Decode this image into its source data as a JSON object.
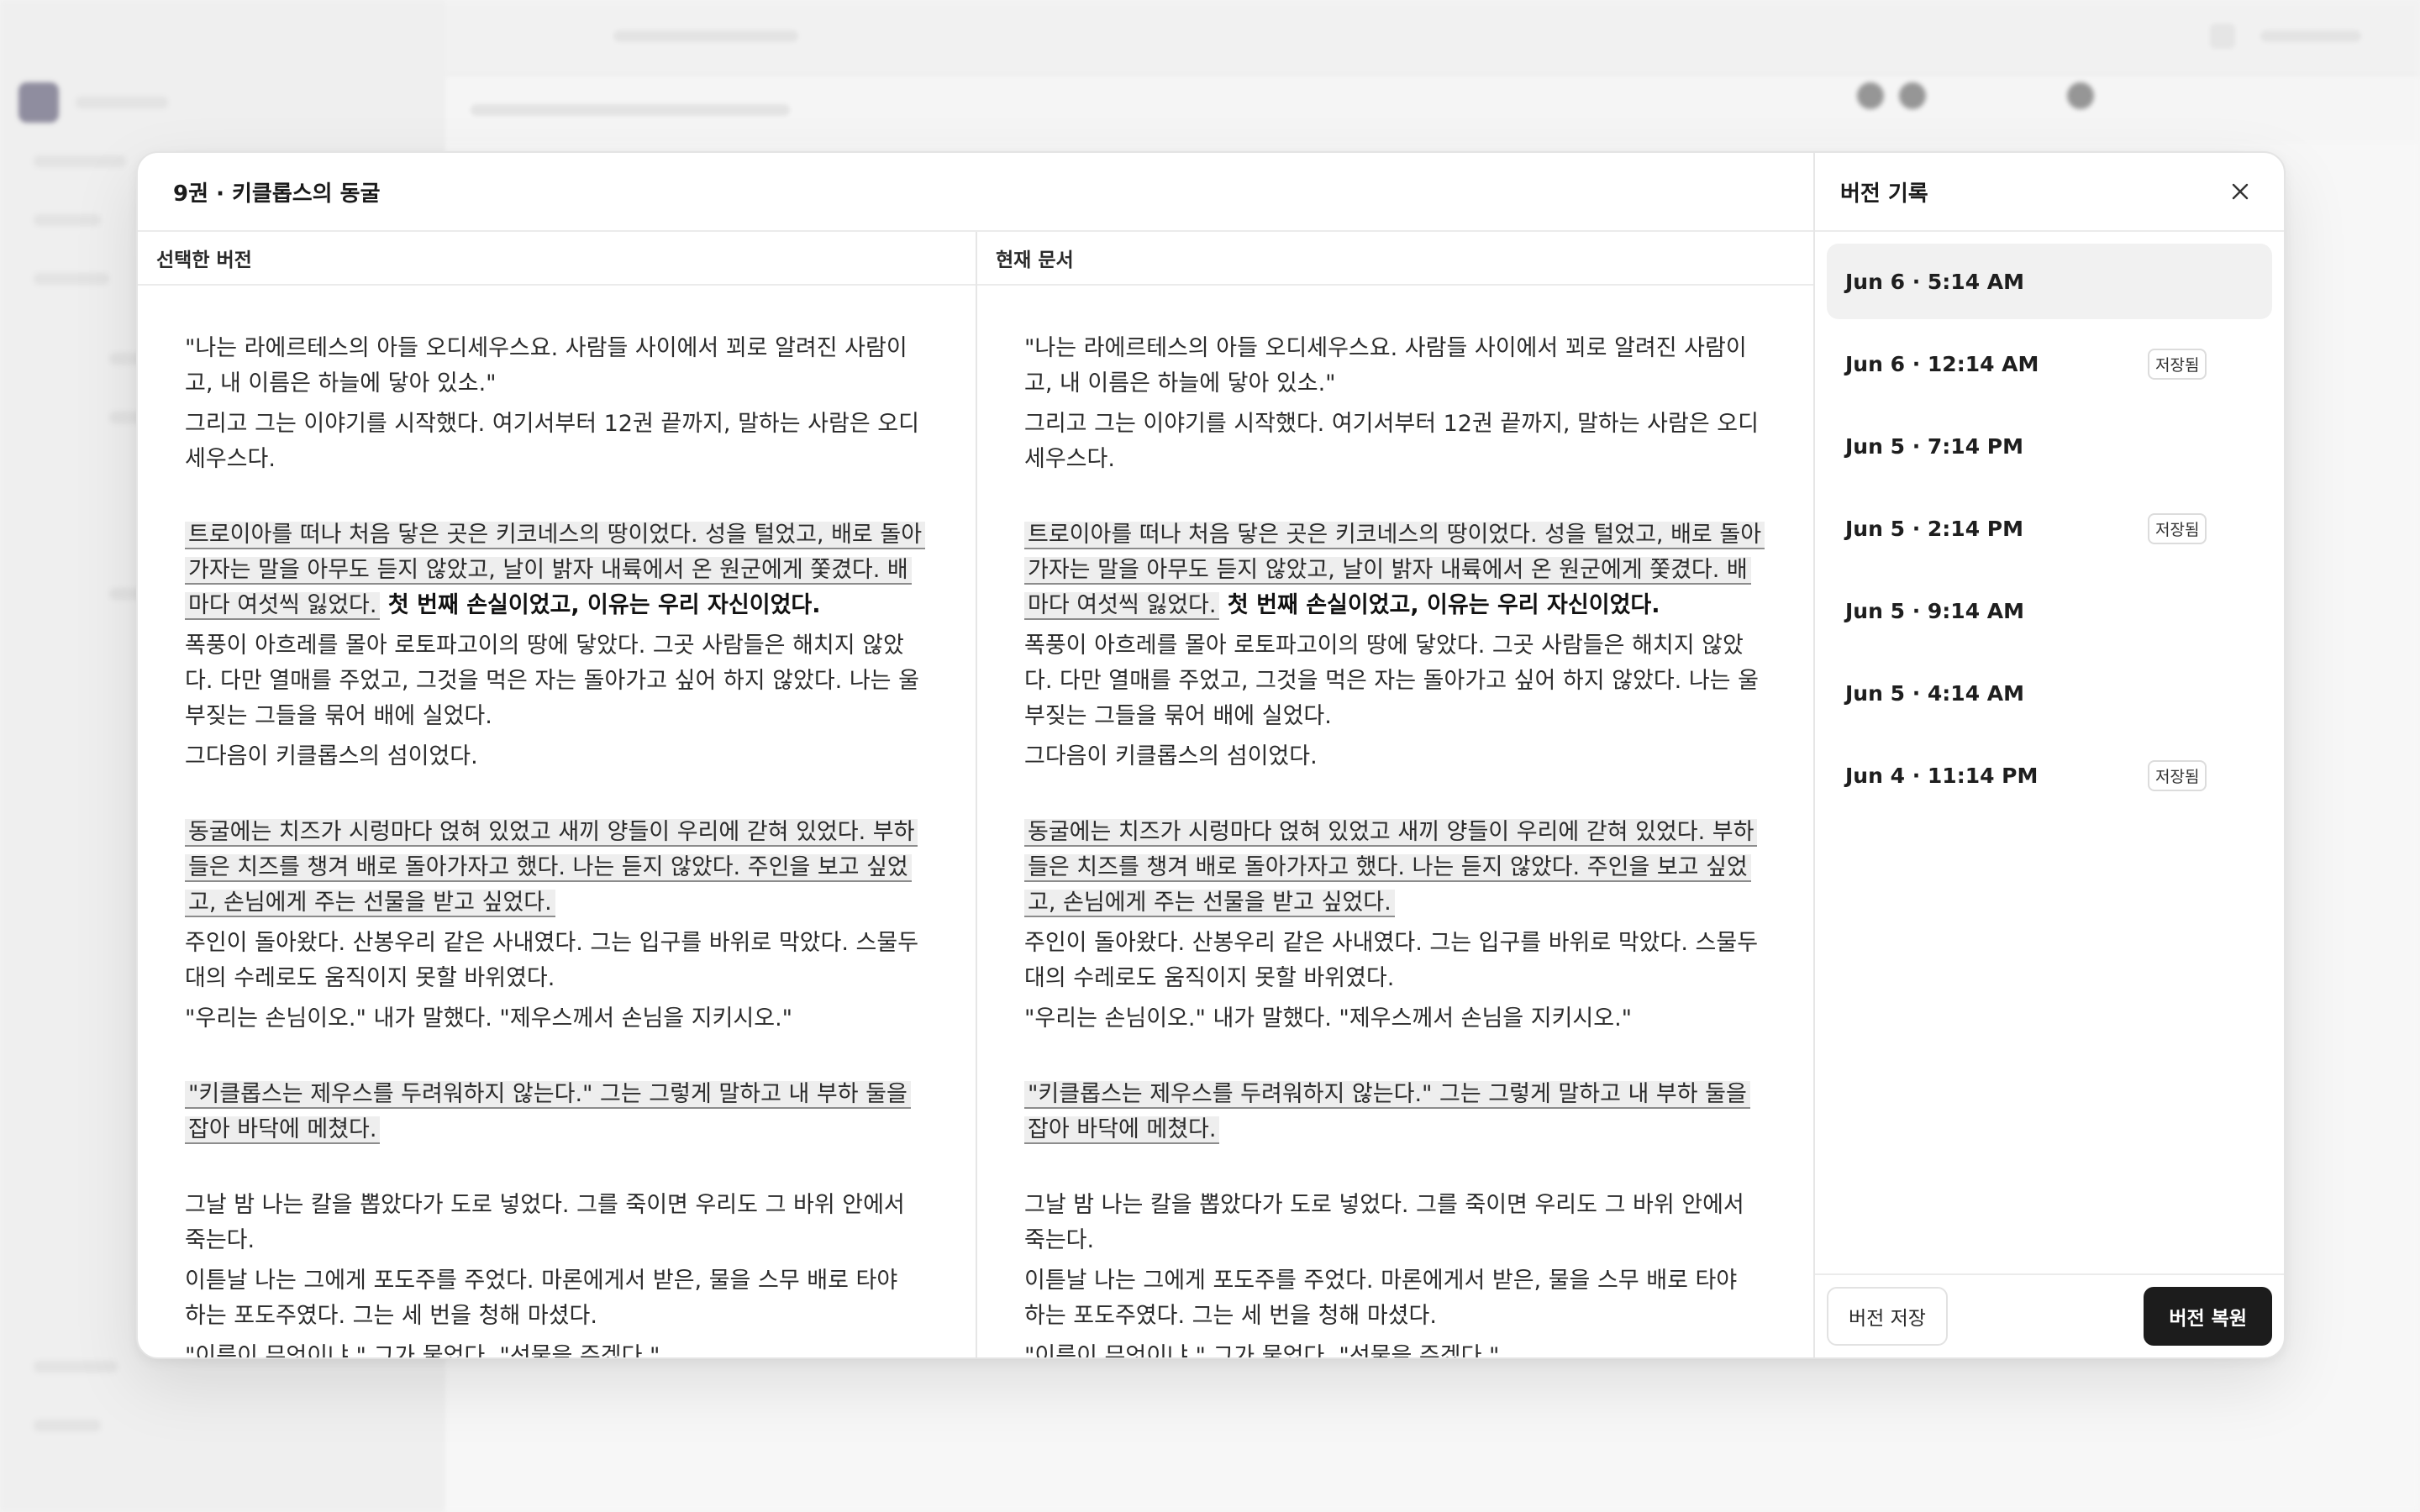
{
  "modal": {
    "title": "9권 · 키클롭스의 동굴"
  },
  "columns": [
    {
      "header": "선택한 버전",
      "paragraphs": [
        {
          "plain": "\"나는 라에르테스의 아들 오디세우스요. 사람들 사이에서 꾀로 알려진 사람이고, 내 이름은 하늘에 닿아 있소.\""
        },
        {
          "plain": "그리고 그는 이야기를 시작했다. 여기서부터 12권 끝까지, 말하는 사람은 오디세우스다."
        },
        {
          "highlight": "트로이아를 떠나 처음 닿은 곳은 키코네스의 땅이었다. 성을 털었고, 배로 돌아가자는 말을 아무도 듣지 않았고, 날이 밝자 내륙에서 온 원군에게 쫓겼다. 배마다 여섯씩 잃었다.",
          "bold": " 첫 번째 손실이었고, 이유는 우리 자신이었다."
        },
        {
          "plain": "폭풍이 아흐레를 몰아 로토파고이의 땅에 닿았다. 그곳 사람들은 해치지 않았다. 다만 열매를 주었고, 그것을 먹은 자는 돌아가고 싶어 하지 않았다. 나는 울부짖는 그들을 묶어 배에 실었다."
        },
        {
          "plain": "그다음이 키클롭스의 섬이었다."
        },
        {
          "highlight": "동굴에는 치즈가 시렁마다 얹혀 있었고 새끼 양들이 우리에 갇혀 있었다. 부하들은 치즈를 챙겨 배로 돌아가자고 했다. 나는 듣지 않았다. 주인을 보고 싶었고, 손님에게 주는 선물을 받고 싶었다."
        },
        {
          "plain": "주인이 돌아왔다. 산봉우리 같은 사내였다. 그는 입구를 바위로 막았다. 스물두 대의 수레로도 움직이지 못할 바위였다."
        },
        {
          "plain": "\"우리는 손님이오.\" 내가 말했다. \"제우스께서 손님을 지키시오.\""
        },
        {
          "highlight": "\"키클롭스는 제우스를 두려워하지 않는다.\" 그는 그렇게 말하고 내 부하 둘을 잡아 바닥에 메쳤다."
        },
        {
          "plain": "그날 밤 나는 칼을 뽑았다가 도로 넣었다. 그를 죽이면 우리도 그 바위 안에서 죽는다."
        },
        {
          "plain": "이튿날 나는 그에게 포도주를 주었다. 마론에게서 받은, 물을 스무 배로 타야 하는 포도주였다. 그는 세 번을 청해 마셨다."
        },
        {
          "plain": "\"이름이 무엇이냐.\" 그가 물었다. \"선물을 주겠다.\""
        }
      ]
    },
    {
      "header": "현재 문서",
      "paragraphs": [
        {
          "plain": "\"나는 라에르테스의 아들 오디세우스요. 사람들 사이에서 꾀로 알려진 사람이고, 내 이름은 하늘에 닿아 있소.\""
        },
        {
          "plain": "그리고 그는 이야기를 시작했다. 여기서부터 12권 끝까지, 말하는 사람은 오디세우스다."
        },
        {
          "highlight": "트로이아를 떠나 처음 닿은 곳은 키코네스의 땅이었다. 성을 털었고, 배로 돌아가자는 말을 아무도 듣지 않았고, 날이 밝자 내륙에서 온 원군에게 쫓겼다. 배마다 여섯씩 잃었다.",
          "bold": " 첫 번째 손실이었고, 이유는 우리 자신이었다."
        },
        {
          "plain": "폭풍이 아흐레를 몰아 로토파고이의 땅에 닿았다. 그곳 사람들은 해치지 않았다. 다만 열매를 주었고, 그것을 먹은 자는 돌아가고 싶어 하지 않았다. 나는 울부짖는 그들을 묶어 배에 실었다."
        },
        {
          "plain": "그다음이 키클롭스의 섬이었다."
        },
        {
          "highlight": "동굴에는 치즈가 시렁마다 얹혀 있었고 새끼 양들이 우리에 갇혀 있었다. 부하들은 치즈를 챙겨 배로 돌아가자고 했다. 나는 듣지 않았다. 주인을 보고 싶었고, 손님에게 주는 선물을 받고 싶었다."
        },
        {
          "plain": "주인이 돌아왔다. 산봉우리 같은 사내였다. 그는 입구를 바위로 막았다. 스물두 대의 수레로도 움직이지 못할 바위였다."
        },
        {
          "plain": "\"우리는 손님이오.\" 내가 말했다. \"제우스께서 손님을 지키시오.\""
        },
        {
          "highlight": "\"키클롭스는 제우스를 두려워하지 않는다.\" 그는 그렇게 말하고 내 부하 둘을 잡아 바닥에 메쳤다."
        },
        {
          "plain": "그날 밤 나는 칼을 뽑았다가 도로 넣었다. 그를 죽이면 우리도 그 바위 안에서 죽는다."
        },
        {
          "plain": "이튿날 나는 그에게 포도주를 주었다. 마론에게서 받은, 물을 스무 배로 타야 하는 포도주였다. 그는 세 번을 청해 마셨다."
        },
        {
          "plain": "\"이름이 무엇이냐.\" 그가 물었다. \"선물을 주겠다.\""
        }
      ]
    }
  ],
  "history": {
    "title": "버전 기록",
    "close_icon": "close-icon",
    "versions": [
      {
        "time": "Jun 6 · 5:14 AM",
        "saved": "",
        "selected": true
      },
      {
        "time": "Jun 6 · 12:14 AM",
        "saved": "저장됨",
        "selected": false
      },
      {
        "time": "Jun 5 · 7:14 PM",
        "saved": "",
        "selected": false
      },
      {
        "time": "Jun 5 · 2:14 PM",
        "saved": "저장됨",
        "selected": false
      },
      {
        "time": "Jun 5 · 9:14 AM",
        "saved": "",
        "selected": false
      },
      {
        "time": "Jun 5 · 4:14 AM",
        "saved": "",
        "selected": false
      },
      {
        "time": "Jun 4 · 11:14 PM",
        "saved": "저장됨",
        "selected": false
      }
    ],
    "save_button": "버전 저장",
    "restore_button": "버전 복원"
  },
  "colors": {
    "primary_button": "#1c1c1c",
    "highlight_bg": "#eeeeee",
    "selected_row": "#f1f1f1"
  }
}
